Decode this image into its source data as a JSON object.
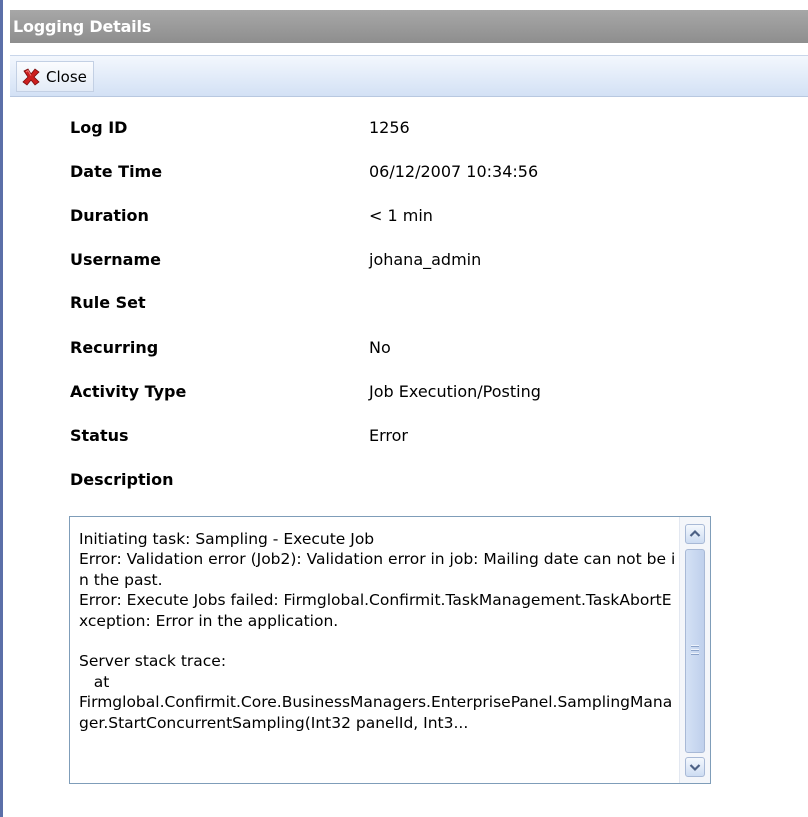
{
  "window": {
    "title": "Logging Details"
  },
  "toolbar": {
    "close_label": "Close"
  },
  "fields": [
    {
      "label": "Log ID",
      "value": "1256"
    },
    {
      "label": "Date Time",
      "value": "06/12/2007 10:34:56"
    },
    {
      "label": "Duration",
      "value": "< 1 min"
    },
    {
      "label": "Username",
      "value": "johana_admin"
    },
    {
      "label": "Rule Set",
      "value": ""
    },
    {
      "label": "Recurring",
      "value": "No"
    },
    {
      "label": "Activity Type",
      "value": "Job Execution/Posting"
    },
    {
      "label": "Status",
      "value": "Error"
    },
    {
      "label": "Description",
      "value": ""
    }
  ],
  "description": {
    "text": "Initiating task: Sampling - Execute Job\nError: Validation error (Job2): Validation error in job: Mailing date can not be in the past.\nError: Execute Jobs failed: Firmglobal.Confirmit.TaskManagement.TaskAbortException: Error in the application.\n\nServer stack trace:\n   at\nFirmglobal.Confirmit.Core.BusinessManagers.EnterprisePanel.SamplingManager.StartConcurrentSampling(Int32 panelId, Int3..."
  },
  "colors": {
    "title_bar": "#9a9a9a",
    "toolbar": "#dfe8f6",
    "close_icon": "#cc1f1f"
  },
  "icons": {
    "close": "close-icon",
    "scroll_up": "chevron-up-icon",
    "scroll_down": "chevron-down-icon"
  }
}
